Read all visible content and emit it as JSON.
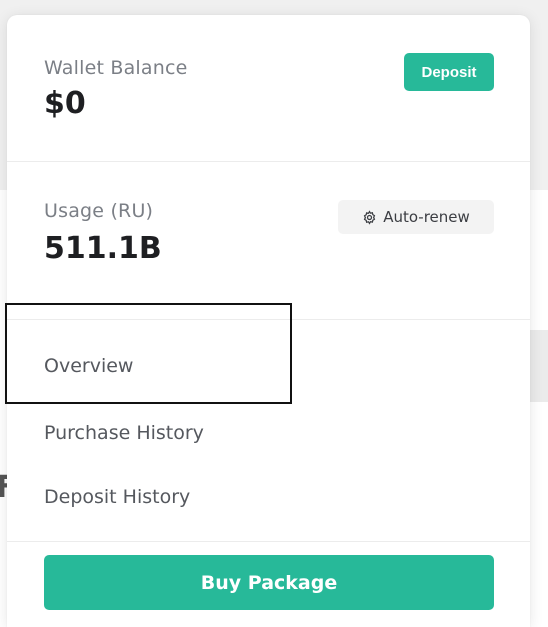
{
  "wallet": {
    "label": "Wallet Balance",
    "value": "$0",
    "deposit_label": "Deposit"
  },
  "usage": {
    "label": "Usage (RU)",
    "value": "511.1B",
    "auto_renew_label": "Auto-renew",
    "auto_renew_icon": "gear-icon"
  },
  "nav": {
    "items": [
      {
        "label": "Overview"
      },
      {
        "label": "Purchase History"
      },
      {
        "label": "Deposit History"
      }
    ]
  },
  "actions": {
    "buy_label": "Buy Package"
  },
  "background": {
    "fragment_letter": "F"
  },
  "colors": {
    "accent": "#27b999",
    "text_primary": "#1e1f22",
    "text_secondary": "#7b7f86"
  }
}
